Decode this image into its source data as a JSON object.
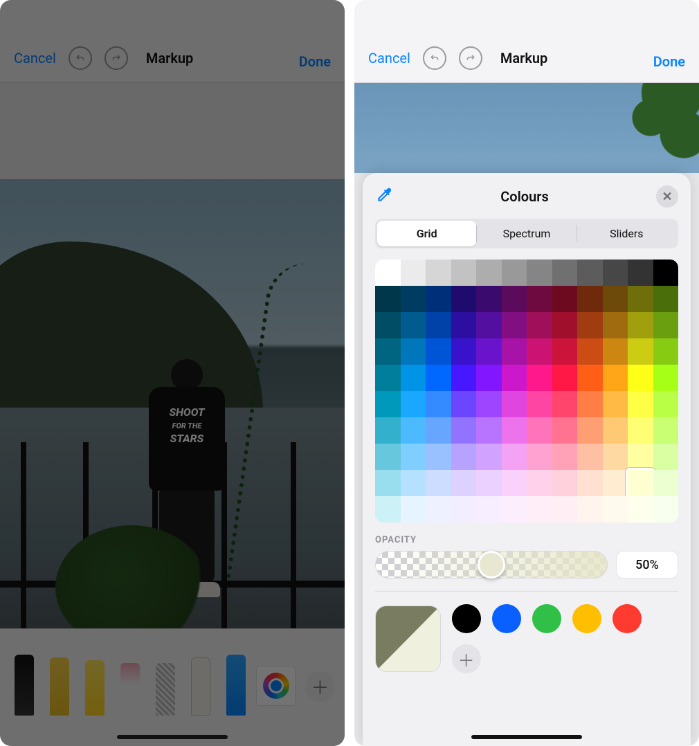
{
  "toolbar": {
    "cancel": "Cancel",
    "title": "Markup",
    "done": "Done"
  },
  "tools": {
    "items": [
      "pen",
      "marker",
      "highlighter",
      "eraser",
      "lasso",
      "ruler",
      "pencil"
    ],
    "selected_color": "#0a84ff"
  },
  "shirt": {
    "line1": "SHOOT",
    "line2": "FOR THE",
    "line3": "STARS"
  },
  "color_sheet": {
    "title": "Colours",
    "tabs": [
      "Grid",
      "Spectrum",
      "Sliders"
    ],
    "active_tab": 0,
    "opacity_label": "OPACITY",
    "opacity_value": "50%",
    "opacity_fraction": 0.5,
    "grid": {
      "cols": 12,
      "rows": [
        [
          "#ffffff",
          "#ebebeb",
          "#d6d6d6",
          "#c2c2c2",
          "#adadad",
          "#999999",
          "#858585",
          "#707070",
          "#5c5c5c",
          "#474747",
          "#333333",
          "#000000"
        ],
        [
          "#00374a",
          "#003c62",
          "#002f7a",
          "#1f0a6e",
          "#3a0a6e",
          "#5c0a5c",
          "#6e0a3f",
          "#6e0a1f",
          "#6e2a0a",
          "#6e4a0a",
          "#6e6e0a",
          "#4a6e0a"
        ],
        [
          "#004d65",
          "#005b8f",
          "#0042a8",
          "#2c0fa0",
          "#520fa0",
          "#820f82",
          "#a00f5a",
          "#a00f2c",
          "#a03c0f",
          "#a06a0f",
          "#a0a00f",
          "#6aa00f"
        ],
        [
          "#006580",
          "#0077bb",
          "#0055d6",
          "#3913cc",
          "#6a13cc",
          "#a713a7",
          "#cc1373",
          "#cc1339",
          "#cc4d13",
          "#cc8713",
          "#cccc13",
          "#87cc13"
        ],
        [
          "#007e9c",
          "#0093e6",
          "#0068ff",
          "#4617ff",
          "#8217ff",
          "#cc17cc",
          "#ff178c",
          "#ff1746",
          "#ff5e17",
          "#ffa517",
          "#ffff17",
          "#a5ff17"
        ],
        [
          "#0098bb",
          "#1aa7ff",
          "#338bff",
          "#6b45ff",
          "#9e45ff",
          "#e045e0",
          "#ff45a3",
          "#ff456b",
          "#ff7e45",
          "#ffb945",
          "#ffff45",
          "#b9ff45"
        ],
        [
          "#33b0cc",
          "#4dbaff",
          "#66a6ff",
          "#9173ff",
          "#b873ff",
          "#ec73ec",
          "#ff73ba",
          "#ff7391",
          "#ff9e73",
          "#ffc973",
          "#ffff73",
          "#c9ff73"
        ],
        [
          "#66c7dd",
          "#80cdff",
          "#99c1ff",
          "#b7a2ff",
          "#d1a2ff",
          "#f4a2f4",
          "#ffa2d1",
          "#ffa2b7",
          "#ffbfa2",
          "#ffd9a2",
          "#ffffa2",
          "#d9ffa2"
        ],
        [
          "#99deee",
          "#b3e1ff",
          "#ccddff",
          "#ddd1ff",
          "#ead1ff",
          "#fad1fa",
          "#ffd1ea",
          "#ffd1dd",
          "#ffe0d1",
          "#ffecd1",
          "#ffffd1",
          "#ecffd1"
        ],
        [
          "#ccf2f8",
          "#e6f4ff",
          "#eef1ff",
          "#f3eeff",
          "#f7eeff",
          "#fceefc",
          "#ffeef7",
          "#ffeef3",
          "#fff4ee",
          "#fff9ee",
          "#ffffee",
          "#f9ffee"
        ]
      ],
      "selected": {
        "row": 8,
        "col": 10
      }
    },
    "preview_colors": {
      "top": "#7a7c62",
      "bottom": "#eff0dd"
    },
    "presets": [
      "#000000",
      "#0a60ff",
      "#30c048",
      "#ffbf00",
      "#ff3b30"
    ]
  }
}
